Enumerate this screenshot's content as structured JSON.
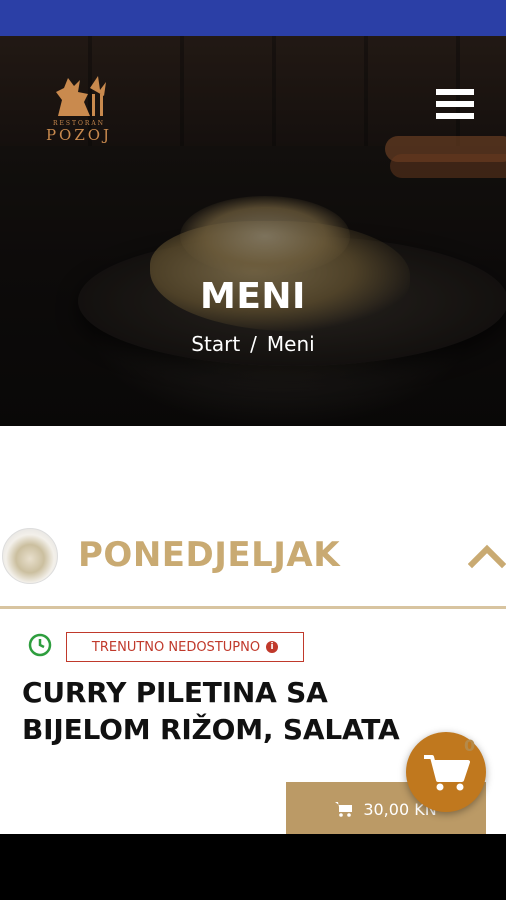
{
  "header": {
    "logo_subtitle": "RESTORAN",
    "logo_name": "POZOJ",
    "page_title": "MENI",
    "breadcrumb": {
      "home": "Start",
      "separator": "/",
      "current": "Meni"
    }
  },
  "menu": {
    "day": "PONEDJELJAK",
    "item": {
      "status": "TRENUTNO NEDOSTUPNO",
      "status_info": "i",
      "name": "CURRY PILETINA SA BIJELOM RIŽOM, SALATA",
      "price": "30,00 KN"
    }
  },
  "cart": {
    "count": "0"
  },
  "colors": {
    "status_bar": "#2b3fa6",
    "accent_gold": "#c9aa72",
    "price_button": "#bb9a66",
    "cart_orange": "#c0781e",
    "unavailable_red": "#c0392b",
    "clock_green": "#2e9e3e"
  },
  "icons": {
    "menu": "hamburger-icon",
    "collapse": "chevron-up-icon",
    "clock": "clock-icon",
    "info": "info-icon",
    "cart": "shopping-cart-icon"
  }
}
